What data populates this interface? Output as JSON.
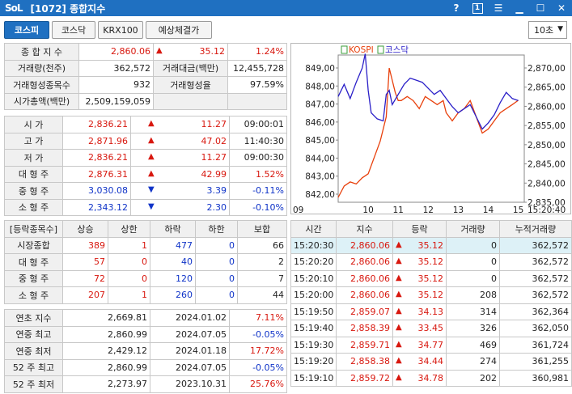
{
  "window": {
    "logo": "SoL",
    "title": "[1072] 종합지수",
    "help_label": "?",
    "page_label": "1"
  },
  "tabs": [
    {
      "label": "코스피"
    },
    {
      "label": "코스닥"
    },
    {
      "label": "KRX100"
    },
    {
      "label": "예상체결가"
    }
  ],
  "interval": {
    "value": "10초"
  },
  "summary": {
    "composite_label": "종 합 지 수",
    "composite_value": "2,860.06",
    "composite_change": "35.12",
    "composite_rate": "1.24%",
    "volume_label": "거래량(천주)",
    "volume_value": "362,572",
    "amount_label": "거래대금(백만)",
    "amount_value": "12,455,728",
    "formed_count_label": "거래형성종목수",
    "formed_count_value": "932",
    "formed_rate_label": "거래형성율",
    "formed_rate_value": "97.59%",
    "market_cap_label": "시가총액(백만)",
    "market_cap_value": "2,509,159,059"
  },
  "prices": [
    {
      "label": "시      가",
      "value": "2,836.21",
      "dir": "up",
      "change": "11.27",
      "extra": "09:00:01",
      "color": "red"
    },
    {
      "label": "고      가",
      "value": "2,871.96",
      "dir": "up",
      "change": "47.02",
      "extra": "11:40:30",
      "color": "red"
    },
    {
      "label": "저      가",
      "value": "2,836.21",
      "dir": "up",
      "change": "11.27",
      "extra": "09:00:30",
      "color": "red"
    },
    {
      "label": "대 형 주",
      "value": "2,876.31",
      "dir": "up",
      "change": "42.99",
      "extra": "1.52%",
      "color": "red"
    },
    {
      "label": "중 형 주",
      "value": "3,030.08",
      "dir": "down",
      "change": "3.39",
      "extra": "-0.11%",
      "color": "blue"
    },
    {
      "label": "소 형 주",
      "value": "2,343.12",
      "dir": "down",
      "change": "2.30",
      "extra": "-0.10%",
      "color": "blue"
    }
  ],
  "breadth": {
    "headers": [
      "[등락종목수]",
      "상승",
      "상한",
      "하락",
      "하한",
      "보합"
    ],
    "rows": [
      {
        "label": "시장종합",
        "up": "389",
        "upper": "1",
        "down": "477",
        "lower": "0",
        "flat": "66"
      },
      {
        "label": "대 형 주",
        "up": "57",
        "upper": "0",
        "down": "40",
        "lower": "0",
        "flat": "2"
      },
      {
        "label": "중 형 주",
        "up": "72",
        "upper": "0",
        "down": "120",
        "lower": "0",
        "flat": "7"
      },
      {
        "label": "소 형 주",
        "up": "207",
        "upper": "1",
        "down": "260",
        "lower": "0",
        "flat": "44"
      }
    ]
  },
  "extremes": [
    {
      "label": "연초  지수",
      "value": "2,669.81",
      "date": "2024.01.02",
      "rate": "7.11%",
      "color": "red"
    },
    {
      "label": "연중  최고",
      "value": "2,860.99",
      "date": "2024.07.05",
      "rate": "-0.05%",
      "color": "blue"
    },
    {
      "label": "연중  최저",
      "value": "2,429.12",
      "date": "2024.01.18",
      "rate": "17.72%",
      "color": "red"
    },
    {
      "label": "52 주 최고",
      "value": "2,860.99",
      "date": "2024.07.05",
      "rate": "-0.05%",
      "color": "blue"
    },
    {
      "label": "52 주 최저",
      "value": "2,273.97",
      "date": "2023.10.31",
      "rate": "25.76%",
      "color": "red"
    }
  ],
  "ticks": {
    "headers": [
      "시간",
      "지수",
      "등락",
      "거래량",
      "누적거래량"
    ],
    "rows": [
      {
        "time": "15:20:30",
        "index": "2,860.06",
        "change": "35.12",
        "vol": "0",
        "cum": "362,572"
      },
      {
        "time": "15:20:20",
        "index": "2,860.06",
        "change": "35.12",
        "vol": "0",
        "cum": "362,572"
      },
      {
        "time": "15:20:10",
        "index": "2,860.06",
        "change": "35.12",
        "vol": "0",
        "cum": "362,572"
      },
      {
        "time": "15:20:00",
        "index": "2,860.06",
        "change": "35.12",
        "vol": "208",
        "cum": "362,572"
      },
      {
        "time": "15:19:50",
        "index": "2,859.07",
        "change": "34.13",
        "vol": "314",
        "cum": "362,364"
      },
      {
        "time": "15:19:40",
        "index": "2,858.39",
        "change": "33.45",
        "vol": "326",
        "cum": "362,050"
      },
      {
        "time": "15:19:30",
        "index": "2,859.71",
        "change": "34.77",
        "vol": "469",
        "cum": "361,724"
      },
      {
        "time": "15:19:20",
        "index": "2,858.38",
        "change": "34.44",
        "vol": "274",
        "cum": "361,255"
      },
      {
        "time": "15:19:10",
        "index": "2,859.72",
        "change": "34.78",
        "vol": "202",
        "cum": "360,981"
      }
    ]
  },
  "chart_data": {
    "type": "line",
    "legend": [
      "KOSPI",
      "코스닥"
    ],
    "colors": {
      "KOSPI": "#e8400c",
      "KOSDAQ": "#2a1fc8"
    },
    "x_ticks": [
      "09",
      "10",
      "11",
      "12",
      "13",
      "14",
      "15",
      "15:20:40"
    ],
    "y_left_ticks": [
      "849,00",
      "848,00",
      "847,00",
      "846,00",
      "845,00",
      "844,00",
      "843,00",
      "842,00"
    ],
    "y_right_ticks": [
      "2,870,00",
      "2,865,00",
      "2,860,00",
      "2,855,00",
      "2,850,00",
      "2,845,00",
      "2,840,00",
      "2,835,00"
    ],
    "y_left_range": [
      842,
      849
    ],
    "y_right_range": [
      2835,
      2870
    ],
    "series": [
      {
        "name": "KOSPI",
        "axis": "right",
        "points": [
          [
            0,
            2836.2
          ],
          [
            0.2,
            2839
          ],
          [
            0.4,
            2840
          ],
          [
            0.6,
            2839.5
          ],
          [
            0.8,
            2841
          ],
          [
            1.0,
            2842
          ],
          [
            1.2,
            2846
          ],
          [
            1.4,
            2850
          ],
          [
            1.6,
            2856
          ],
          [
            1.7,
            2868
          ],
          [
            1.8,
            2865
          ],
          [
            1.9,
            2862
          ],
          [
            2.0,
            2860
          ],
          [
            2.1,
            2860
          ],
          [
            2.3,
            2861
          ],
          [
            2.5,
            2860
          ],
          [
            2.7,
            2858
          ],
          [
            2.9,
            2861
          ],
          [
            3.1,
            2860
          ],
          [
            3.3,
            2859
          ],
          [
            3.5,
            2860
          ],
          [
            3.6,
            2857
          ],
          [
            3.8,
            2855
          ],
          [
            4.0,
            2857
          ],
          [
            4.2,
            2858
          ],
          [
            4.4,
            2860
          ],
          [
            4.5,
            2858
          ],
          [
            4.6,
            2856
          ],
          [
            4.8,
            2852
          ],
          [
            5.0,
            2853
          ],
          [
            5.2,
            2855
          ],
          [
            5.4,
            2857
          ],
          [
            5.6,
            2858
          ],
          [
            5.8,
            2859
          ],
          [
            6.0,
            2860.06
          ]
        ]
      },
      {
        "name": "코스닥",
        "axis": "left",
        "points": [
          [
            0,
            847.2
          ],
          [
            0.2,
            847.8
          ],
          [
            0.4,
            847.1
          ],
          [
            0.6,
            847.9
          ],
          [
            0.8,
            848.6
          ],
          [
            0.9,
            849.3
          ],
          [
            1.0,
            847.5
          ],
          [
            1.1,
            846.4
          ],
          [
            1.3,
            846.1
          ],
          [
            1.5,
            846.0
          ],
          [
            1.6,
            847.3
          ],
          [
            1.7,
            847.5
          ],
          [
            1.8,
            846.8
          ],
          [
            2.0,
            847.3
          ],
          [
            2.2,
            847.8
          ],
          [
            2.4,
            848.1
          ],
          [
            2.6,
            848.0
          ],
          [
            2.8,
            847.9
          ],
          [
            3.0,
            847.6
          ],
          [
            3.2,
            847.3
          ],
          [
            3.4,
            847.5
          ],
          [
            3.6,
            847.1
          ],
          [
            3.8,
            846.7
          ],
          [
            4.0,
            846.4
          ],
          [
            4.2,
            846.6
          ],
          [
            4.4,
            846.8
          ],
          [
            4.6,
            846.2
          ],
          [
            4.8,
            845.6
          ],
          [
            5.0,
            845.9
          ],
          [
            5.2,
            846.3
          ],
          [
            5.4,
            846.9
          ],
          [
            5.6,
            847.4
          ],
          [
            5.8,
            847.1
          ],
          [
            6.0,
            847.0
          ]
        ]
      }
    ]
  }
}
